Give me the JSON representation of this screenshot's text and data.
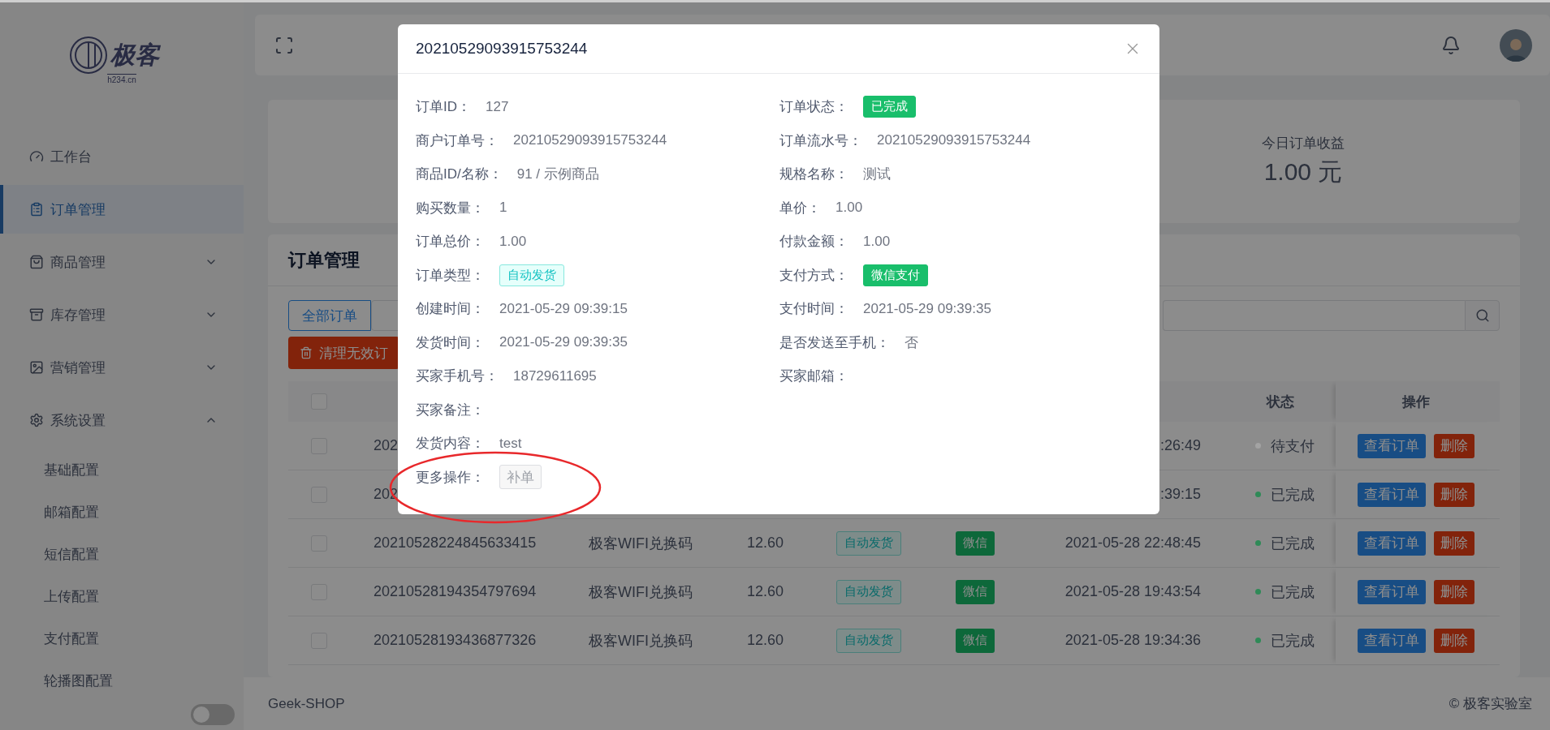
{
  "sidebar": {
    "logo": {
      "name": "极客",
      "domain": "h234.cn"
    },
    "items": [
      {
        "label": "工作台",
        "selected": false
      },
      {
        "label": "订单管理",
        "selected": true
      },
      {
        "label": "商品管理",
        "selected": false,
        "expanded": false
      },
      {
        "label": "库存管理",
        "selected": false,
        "expanded": false
      },
      {
        "label": "营销管理",
        "selected": false,
        "expanded": false
      },
      {
        "label": "系统设置",
        "selected": false,
        "expanded": true,
        "children": [
          {
            "label": "基础配置",
            "selected": false
          },
          {
            "label": "邮箱配置",
            "selected": false
          },
          {
            "label": "短信配置",
            "selected": false
          },
          {
            "label": "上传配置",
            "selected": false
          },
          {
            "label": "支付配置",
            "selected": false
          },
          {
            "label": "轮播图配置",
            "selected": false
          }
        ]
      }
    ],
    "toggle": {
      "on": false
    }
  },
  "stats": [
    {
      "title": "今日订单收益",
      "value": "1.00 元"
    }
  ],
  "orders": {
    "title": "订单管理",
    "tabs": [
      {
        "label": "全部订单",
        "selected": true
      },
      {
        "selected": false
      }
    ],
    "clean_button": "清理无效订",
    "table": {
      "header_checked": false,
      "status_header": "状态",
      "actions_header": "操作",
      "rows": [
        {
          "checked": false,
          "order_no": "202",
          "time": ":26:49",
          "status": "待支付",
          "color": "#a3a3a3",
          "view": "查看订单",
          "delete": "删除"
        },
        {
          "checked": false,
          "order_no": "202",
          "time": ":39:15",
          "status": "已完成",
          "color": "#2f8a57",
          "view": "查看订单",
          "delete": "删除"
        },
        {
          "checked": false,
          "order_no": "20210528224845633415",
          "product": "极客WIFI兑换码",
          "price": "12.60",
          "type": "自动发货",
          "payment": "微信",
          "time": "2021-05-28 22:48:45",
          "status": "已完成",
          "color": "#2f8a57",
          "view": "查看订单",
          "delete": "删除"
        },
        {
          "checked": false,
          "order_no": "20210528194354797694",
          "product": "极客WIFI兑换码",
          "price": "12.60",
          "type": "自动发货",
          "payment": "微信",
          "time": "2021-05-28 19:43:54",
          "status": "已完成",
          "color": "#2f8a57",
          "view": "查看订单",
          "delete": "删除"
        },
        {
          "checked": false,
          "order_no": "20210528193436877326",
          "product": "极客WIFI兑换码",
          "price": "12.60",
          "type": "自动发货",
          "payment": "微信",
          "time": "2021-05-28 19:34:36",
          "status": "已完成",
          "color": "#2f8a57",
          "view": "查看订单",
          "delete": "删除"
        }
      ]
    }
  },
  "footer": {
    "left": "Geek-SHOP",
    "right": "© 极客实验室"
  },
  "modal": {
    "title": "20210529093915753244",
    "left": [
      {
        "kind": "text",
        "label": "订单ID：",
        "value": "127"
      },
      {
        "kind": "text",
        "label": "商户订单号：",
        "value": "20210529093915753244"
      },
      {
        "kind": "text",
        "label": "商品ID/名称：",
        "value": "91 / 示例商品"
      },
      {
        "kind": "text",
        "label": "购买数量：",
        "value": "1"
      },
      {
        "kind": "text",
        "label": "订单总价：",
        "value": "1.00"
      },
      {
        "kind": "tag",
        "label": "订单类型：",
        "value": "自动发货"
      },
      {
        "kind": "text",
        "label": "创建时间：",
        "value": "2021-05-29 09:39:15"
      },
      {
        "kind": "text",
        "label": "发货时间：",
        "value": "2021-05-29 09:39:35"
      },
      {
        "kind": "text",
        "label": "买家手机号：",
        "value": "18729611695"
      },
      {
        "kind": "text",
        "label": "买家备注："
      },
      {
        "kind": "text",
        "label": "发货内容：",
        "value": "test"
      },
      {
        "kind": "button",
        "label": "更多操作：",
        "value": "补单",
        "disabled": true
      }
    ],
    "right": [
      {
        "kind": "badge",
        "label": "订单状态：",
        "value": "已完成"
      },
      {
        "kind": "text",
        "label": "订单流水号：",
        "value": "20210529093915753244"
      },
      {
        "kind": "text",
        "label": "规格名称：",
        "value": "测试"
      },
      {
        "kind": "text",
        "label": "单价：",
        "value": "1.00"
      },
      {
        "kind": "text",
        "label": "付款金额：",
        "value": "1.00"
      },
      {
        "kind": "badge",
        "label": "支付方式：",
        "value": "微信支付"
      },
      {
        "kind": "text",
        "label": "支付时间：",
        "value": "2021-05-29 09:39:35"
      },
      {
        "kind": "text",
        "label": "是否发送至手机：",
        "value": "否"
      },
      {
        "kind": "text",
        "label": "买家邮箱："
      }
    ]
  }
}
